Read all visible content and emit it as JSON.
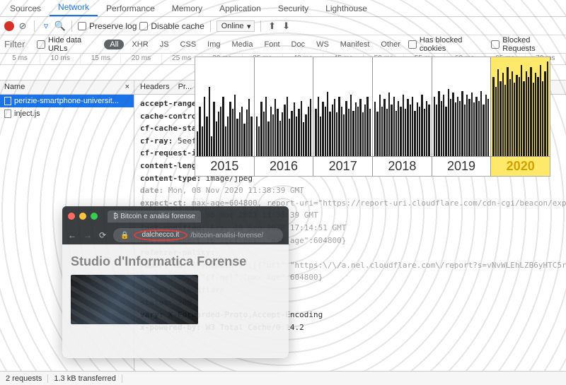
{
  "tabs": [
    "Sources",
    "Network",
    "Performance",
    "Memory",
    "Application",
    "Security",
    "Lighthouse"
  ],
  "activeTab": "Network",
  "toolbar": {
    "preserve_log": "Preserve log",
    "disable_cache": "Disable cache",
    "online": "Online"
  },
  "filterbar": {
    "filter_placeholder": "Filter",
    "hide_data_urls": "Hide data URLs",
    "types": [
      "All",
      "XHR",
      "JS",
      "CSS",
      "Img",
      "Media",
      "Font",
      "Doc",
      "WS",
      "Manifest",
      "Other"
    ],
    "has_blocked": "Has blocked cookies",
    "blocked_req": "Blocked Requests"
  },
  "timeline_ticks": [
    "5 ms",
    "10 ms",
    "15 ms",
    "20 ms",
    "25 ms",
    "30 ms",
    "35 ms",
    "40 ms",
    "45 ms",
    "50 ms",
    "55 ms",
    "60 ms",
    "65 ms",
    "70 ms"
  ],
  "columns": {
    "name": "Name",
    "close": "×",
    "headers": "Headers",
    "preview": "Pr..."
  },
  "requests": [
    {
      "name": "perizie-smartphone-universit...",
      "selected": true
    },
    {
      "name": "inject.js",
      "selected": false
    }
  ],
  "headers": [
    {
      "k": "accept-ranges:",
      "v": ""
    },
    {
      "k": "cache-control:",
      "v": ""
    },
    {
      "k": "cf-cache-status:",
      "v": ""
    },
    {
      "k": "cf-ray:",
      "v": "5eef024"
    },
    {
      "k": "cf-request-id:",
      "v": ""
    },
    {
      "k": "content-length:",
      "v": ""
    },
    {
      "k": "content-type:",
      "v": "image/jpeg"
    },
    {
      "k": "date:",
      "v": "Mon, 08 Nov 2020 11:38:39 GMT",
      "faded": true
    },
    {
      "k": "expect-ct:",
      "v": "max-age=604800, report-uri=\"https://report-uri.cloudflare.com/cdn-cgi/beacon/expect-ct\"",
      "faded": true
    },
    {
      "k": "expires:",
      "v": "Mon, 08 Nov 2021 11:38:39 GMT",
      "faded": true
    },
    {
      "k": "last-modified:",
      "v": "Fri, 18 Sep 2020 17:14:51 GMT",
      "faded": true
    },
    {
      "k": "nel:",
      "v": "{\"report_to\":\"cf-nel\",\"max_age\":604800}",
      "faded": true
    },
    {
      "k": "referrer-policy:",
      "v": "",
      "faded": true
    },
    {
      "k": "report-to:",
      "v": "{\"endpoints\":[{\"url\":\"https:\\/\\/a.nel.cloudflare.com\\/report?s=vNvWLEhLZB6yHTC5rHLdkV0AMGwfhOBqnrBu",
      "faded": true
    },
    {
      "k": "",
      "v": "C\"}],\"group\":\"cf-nel\",\"max_age\":604800}",
      "faded": true
    },
    {
      "k": "server:",
      "v": "cloudflare",
      "faded": true
    },
    {
      "k": "status:",
      "v": "200",
      "faded": true
    },
    {
      "k": "vary:",
      "v": "X-Forwarded-Proto,Accept-Encoding"
    },
    {
      "k": "x-powered-by:",
      "v": "W3 Total Cache/0.14.2"
    }
  ],
  "status": {
    "requests": "2 requests",
    "transferred": "1.3 kB transferred"
  },
  "years_overlay": {
    "years": [
      "2015",
      "2016",
      "2017",
      "2018",
      "2019",
      "2020"
    ],
    "bars": [
      [
        25,
        50,
        30,
        60,
        40,
        70,
        20,
        55,
        35,
        45,
        50,
        60,
        30,
        40,
        55,
        48,
        62,
        38,
        44,
        50,
        33,
        47,
        58,
        40
      ],
      [
        40,
        30,
        55,
        45,
        60,
        35,
        50,
        42,
        58,
        48,
        36,
        44,
        52,
        60,
        38,
        46,
        54,
        40,
        48,
        56,
        34,
        42,
        50,
        58
      ],
      [
        48,
        60,
        40,
        55,
        50,
        65,
        45,
        52,
        58,
        44,
        60,
        50,
        42,
        56,
        48,
        62,
        46,
        54,
        50,
        58,
        44,
        52,
        60,
        48
      ],
      [
        55,
        45,
        62,
        50,
        58,
        48,
        64,
        52,
        60,
        46,
        56,
        50,
        62,
        48,
        58,
        52,
        60,
        46,
        54,
        50,
        62,
        48,
        56,
        52
      ],
      [
        60,
        52,
        66,
        56,
        62,
        50,
        68,
        58,
        64,
        54,
        60,
        56,
        66,
        52,
        62,
        58,
        64,
        54,
        60,
        56,
        66,
        52,
        62,
        58
      ],
      [
        80,
        70,
        88,
        76,
        84,
        72,
        90,
        78,
        86,
        74,
        82,
        80,
        92,
        76,
        86,
        80,
        90,
        74,
        84,
        80,
        92,
        76,
        86,
        96
      ]
    ]
  },
  "browser": {
    "tab_title": "Bitcoin e analisi forense",
    "domain": "dalchecco.it",
    "path": "/bitcoin-analisi-forense/",
    "heading": "Studio d'Informatica Forense"
  }
}
